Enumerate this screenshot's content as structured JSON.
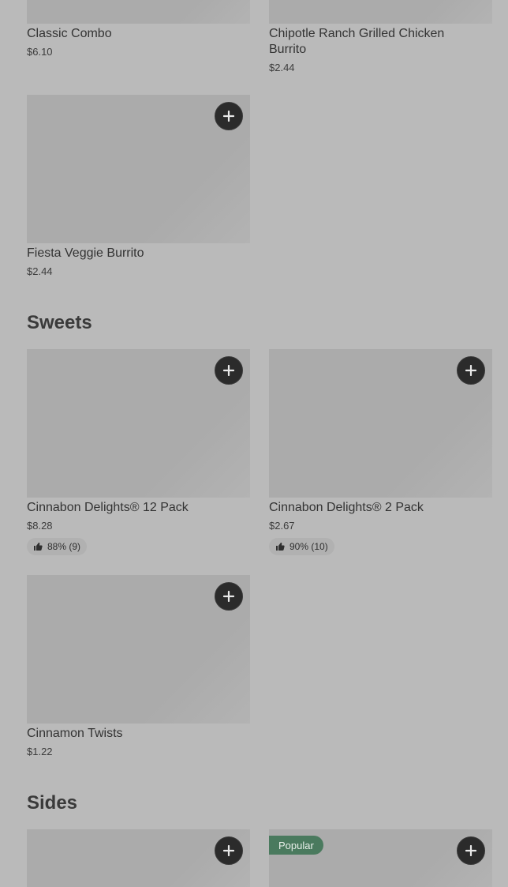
{
  "items": {
    "classic_combo": {
      "name": "Classic Combo",
      "price": "$6.10"
    },
    "chipotle_burrito": {
      "name": "Chipotle Ranch Grilled Chicken Burrito",
      "price": "$2.44"
    },
    "fiesta_veggie": {
      "name": "Fiesta Veggie Burrito",
      "price": "$2.44"
    },
    "cinnabon_12": {
      "name": "Cinnabon Delights® 12 Pack",
      "price": "$8.28",
      "rating": "88% (9)"
    },
    "cinnabon_2": {
      "name": "Cinnabon Delights® 2 Pack",
      "price": "$2.67",
      "rating": "90% (10)"
    },
    "cinnamon_twists": {
      "name": "Cinnamon Twists",
      "price": "$1.22"
    }
  },
  "sections": {
    "sweets": "Sweets",
    "sides": "Sides"
  },
  "badges": {
    "popular": "Popular"
  },
  "icons": {
    "add": "plus-icon",
    "rating": "thumbs-up-icon"
  },
  "colors": {
    "background": "#bababa",
    "add_button": "#2b2b2b",
    "popular_badge": "#4a7a5e"
  }
}
